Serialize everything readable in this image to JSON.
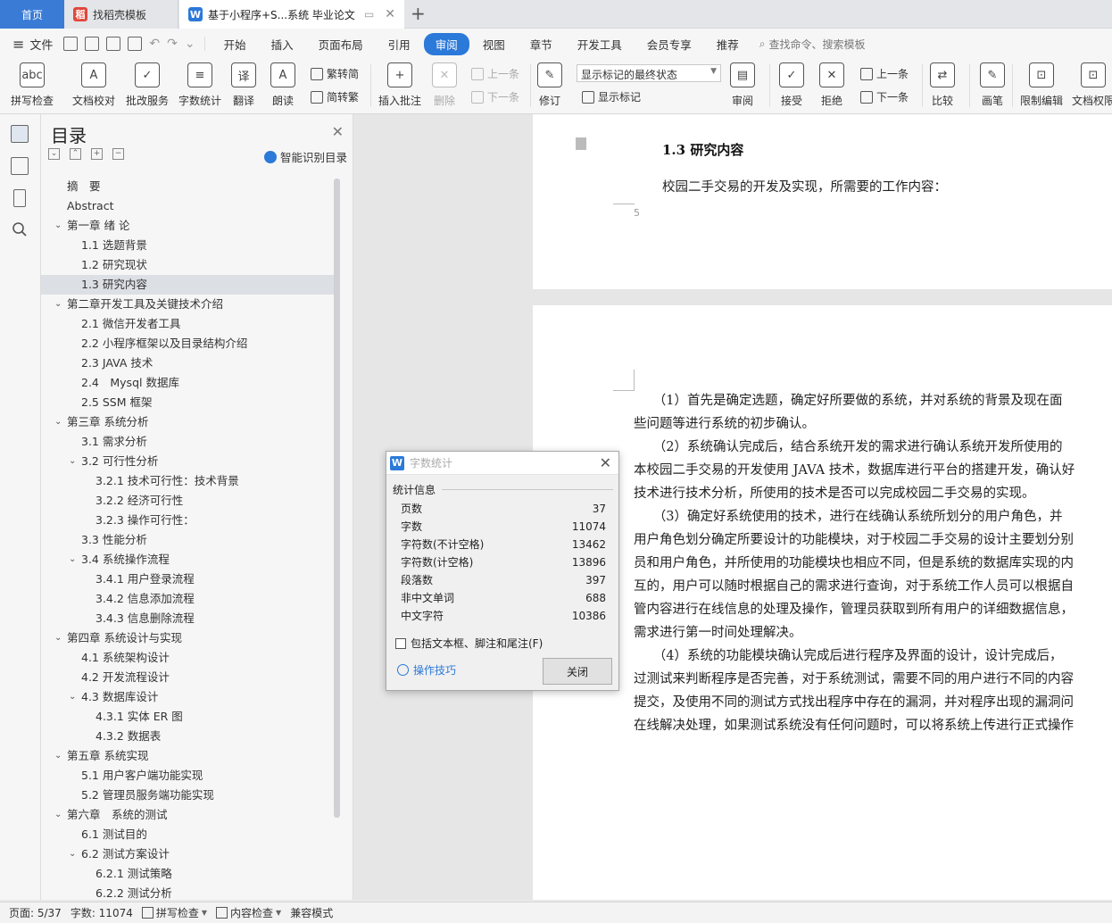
{
  "tabs": {
    "home": "首页",
    "doc1": "找稻壳模板",
    "doc2": "基于小程序+S...系统 毕业论文"
  },
  "menu": {
    "file": "文件",
    "items": [
      "开始",
      "插入",
      "页面布局",
      "引用",
      "审阅",
      "视图",
      "章节",
      "开发工具",
      "会员专享",
      "推荐"
    ],
    "active": "审阅",
    "search": "查找命令、搜索模板"
  },
  "toolbar": {
    "spell": "拼写检查",
    "proof": "文档校对",
    "batch": "批改服务",
    "wordcount": "字数统计",
    "translate": "翻译",
    "read": "朗读",
    "trad2simp": "繁转简",
    "simp2trad": "简转繁",
    "insert_comment": "插入批注",
    "delete": "删除",
    "prev": "上一条",
    "next": "下一条",
    "revise": "修订",
    "markup_state": "显示标记的最终状态",
    "show_markup": "显示标记",
    "review": "审阅",
    "accept": "接受",
    "reject": "拒绝",
    "prev2": "上一条",
    "next2": "下一条",
    "compare": "比较",
    "pen": "画笔",
    "restrict": "限制编辑",
    "doc_perm": "文档权限"
  },
  "toc": {
    "title": "目录",
    "smart": "智能识别目录",
    "items": [
      {
        "label": "摘　要",
        "level": 1,
        "chev": ""
      },
      {
        "label": "Abstract",
        "level": 1,
        "chev": ""
      },
      {
        "label": "第一章 绪 论",
        "level": 1,
        "chev": "v"
      },
      {
        "label": "1.1 选题背景",
        "level": 2,
        "chev": ""
      },
      {
        "label": "1.2 研究现状",
        "level": 2,
        "chev": ""
      },
      {
        "label": "1.3 研究内容",
        "level": 2,
        "chev": "",
        "selected": true
      },
      {
        "label": "第二章开发工具及关键技术介绍",
        "level": 1,
        "chev": "v"
      },
      {
        "label": "2.1 微信开发者工具",
        "level": 2,
        "chev": ""
      },
      {
        "label": "2.2 小程序框架以及目录结构介绍",
        "level": 2,
        "chev": ""
      },
      {
        "label": "2.3 JAVA 技术",
        "level": 2,
        "chev": ""
      },
      {
        "label": "2.4　Mysql 数据库",
        "level": 2,
        "chev": ""
      },
      {
        "label": "2.5 SSM 框架",
        "level": 2,
        "chev": ""
      },
      {
        "label": "第三章 系统分析",
        "level": 1,
        "chev": "v"
      },
      {
        "label": "3.1 需求分析",
        "level": 2,
        "chev": ""
      },
      {
        "label": "3.2 可行性分析",
        "level": 2,
        "chev": "v"
      },
      {
        "label": "3.2.1 技术可行性：技术背景",
        "level": 3,
        "chev": ""
      },
      {
        "label": "3.2.2 经济可行性",
        "level": 3,
        "chev": ""
      },
      {
        "label": "3.2.3 操作可行性：",
        "level": 3,
        "chev": ""
      },
      {
        "label": "3.3 性能分析",
        "level": 2,
        "chev": ""
      },
      {
        "label": "3.4 系统操作流程",
        "level": 2,
        "chev": "v"
      },
      {
        "label": "3.4.1 用户登录流程",
        "level": 3,
        "chev": ""
      },
      {
        "label": "3.4.2 信息添加流程",
        "level": 3,
        "chev": ""
      },
      {
        "label": "3.4.3 信息删除流程",
        "level": 3,
        "chev": ""
      },
      {
        "label": "第四章 系统设计与实现",
        "level": 1,
        "chev": "v"
      },
      {
        "label": "4.1 系统架构设计",
        "level": 2,
        "chev": ""
      },
      {
        "label": "4.2 开发流程设计",
        "level": 2,
        "chev": ""
      },
      {
        "label": "4.3 数据库设计",
        "level": 2,
        "chev": "v"
      },
      {
        "label": "4.3.1 实体 ER 图",
        "level": 3,
        "chev": ""
      },
      {
        "label": "4.3.2 数据表",
        "level": 3,
        "chev": ""
      },
      {
        "label": "第五章 系统实现",
        "level": 1,
        "chev": "v"
      },
      {
        "label": "5.1 用户客户端功能实现",
        "level": 2,
        "chev": ""
      },
      {
        "label": "5.2 管理员服务端功能实现",
        "level": 2,
        "chev": ""
      },
      {
        "label": "第六章　系统的测试",
        "level": 1,
        "chev": "v"
      },
      {
        "label": "6.1 测试目的",
        "level": 2,
        "chev": ""
      },
      {
        "label": "6.2 测试方案设计",
        "level": 2,
        "chev": "v"
      },
      {
        "label": "6.2.1 测试策略",
        "level": 3,
        "chev": ""
      },
      {
        "label": "6.2.2 测试分析",
        "level": 3,
        "chev": ""
      }
    ]
  },
  "document": {
    "heading": "1.3 研究内容",
    "intro": "校园二手交易的开发及实现，所需要的工作内容：",
    "page_number": "5",
    "lines": [
      "　　（1）首先是确定选题，确定好所要做的系统，并对系统的背景及现在面",
      "些问题等进行系统的初步确认。",
      "　　（2）系统确认完成后，结合系统开发的需求进行确认系统开发所使用的",
      "本校园二手交易的开发使用 JAVA 技术，数据库进行平台的搭建开发，确认好",
      "技术进行技术分析，所使用的技术是否可以完成校园二手交易的实现。",
      "　　（3）确定好系统使用的技术，进行在线确认系统所划分的用户角色，并",
      "用户角色划分确定所要设计的功能模块，对于校园二手交易的设计主要划分别",
      "员和用户角色，并所使用的功能模块也相应不同，但是系统的数据库实现的内",
      "互的，用户可以随时根据自己的需求进行查询，对于系统工作人员可以根据自",
      "管内容进行在线信息的处理及操作，管理员获取到所有用户的详细数据信息，",
      "需求进行第一时间处理解决。",
      "　　（4）系统的功能模块确认完成后进行程序及界面的设计，设计完成后，",
      "过测试来判断程序是否完善，对于系统测试，需要不同的用户进行不同的内容",
      "提交，及使用不同的测试方式找出程序中存在的漏洞，并对程序出现的漏洞问",
      "在线解决处理，如果测试系统没有任何问题时，可以将系统上传进行正式操作"
    ]
  },
  "dialog": {
    "title": "字数统计",
    "group": "统计信息",
    "rows": [
      {
        "label": "页数",
        "value": "37"
      },
      {
        "label": "字数",
        "value": "11074"
      },
      {
        "label": "字符数(不计空格)",
        "value": "13462"
      },
      {
        "label": "字符数(计空格)",
        "value": "13896"
      },
      {
        "label": "段落数",
        "value": "397"
      },
      {
        "label": "非中文单词",
        "value": "688"
      },
      {
        "label": "中文字符",
        "value": "10386"
      }
    ],
    "checkbox": "包括文本框、脚注和尾注(F)",
    "tips": "操作技巧",
    "close": "关闭"
  },
  "status": {
    "page": "页面: 5/37",
    "words": "字数: 11074",
    "spell": "拼写检查",
    "content": "内容检查",
    "compat": "兼容模式"
  }
}
